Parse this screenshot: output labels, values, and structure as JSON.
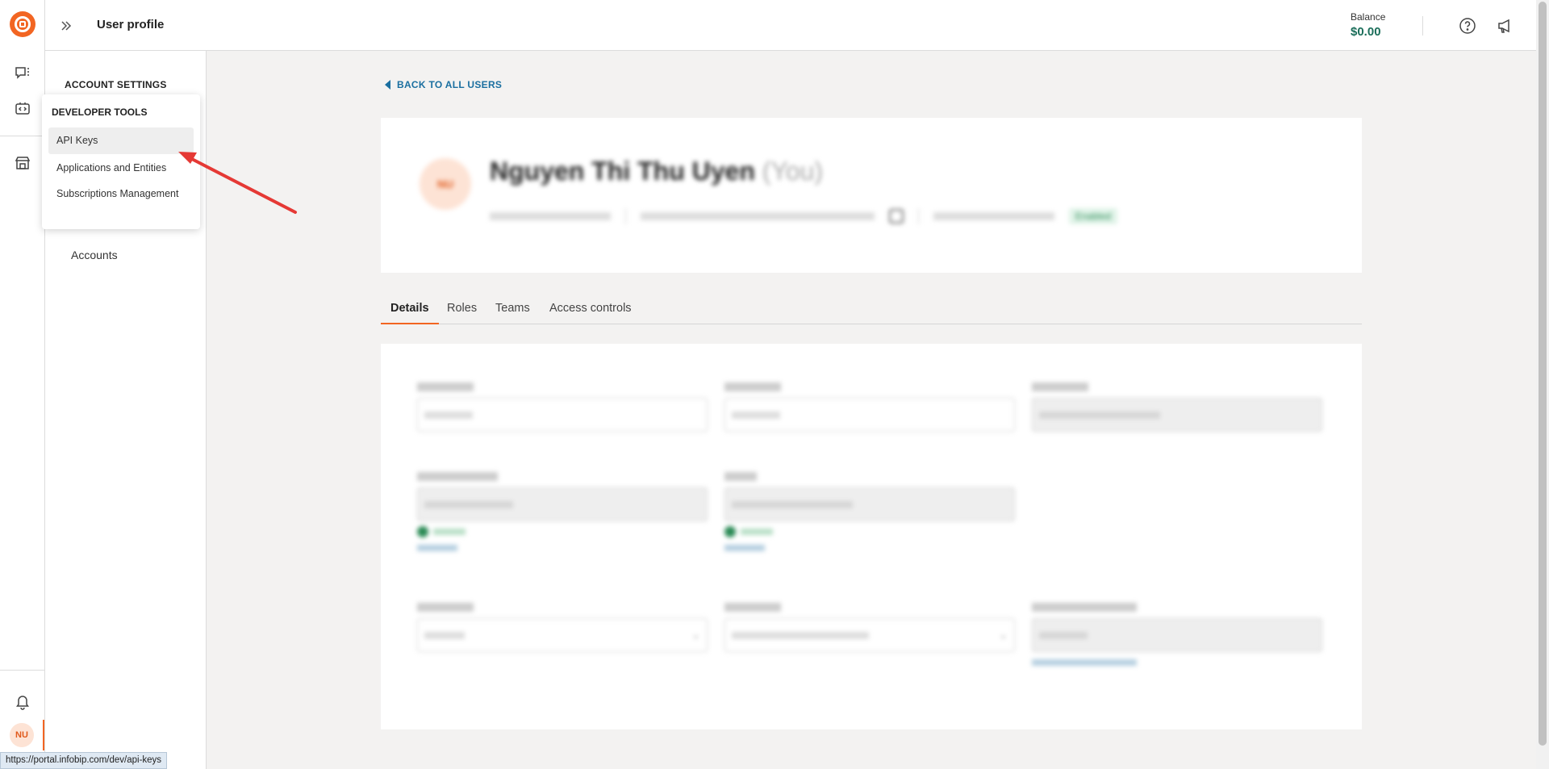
{
  "header": {
    "title": "User profile",
    "balance_label": "Balance",
    "balance_value": "$0.00"
  },
  "sidebar": {
    "section_heading": "ACCOUNT SETTINGS",
    "accounts_label": "Accounts"
  },
  "developer_menu": {
    "heading": "DEVELOPER TOOLS",
    "items": [
      {
        "label": "API Keys"
      },
      {
        "label": "Applications and Entities"
      },
      {
        "label": "Subscriptions Management"
      }
    ]
  },
  "back_link": "BACK TO ALL USERS",
  "profile": {
    "avatar_initials": "NU",
    "name": "Nguyen Thi Thu Uyen",
    "you_tag": "(You)",
    "status": "Enabled"
  },
  "tabs": [
    {
      "label": "Details"
    },
    {
      "label": "Roles"
    },
    {
      "label": "Teams"
    },
    {
      "label": "Access controls"
    }
  ],
  "user_avatar_initials": "NU",
  "status_url": "https://portal.infobip.com/dev/api-keys",
  "colors": {
    "brand_orange": "#f26522",
    "balance_green": "#1b6e5a",
    "link_blue": "#1a6fa0",
    "annotation_arrow": "#e53935"
  }
}
